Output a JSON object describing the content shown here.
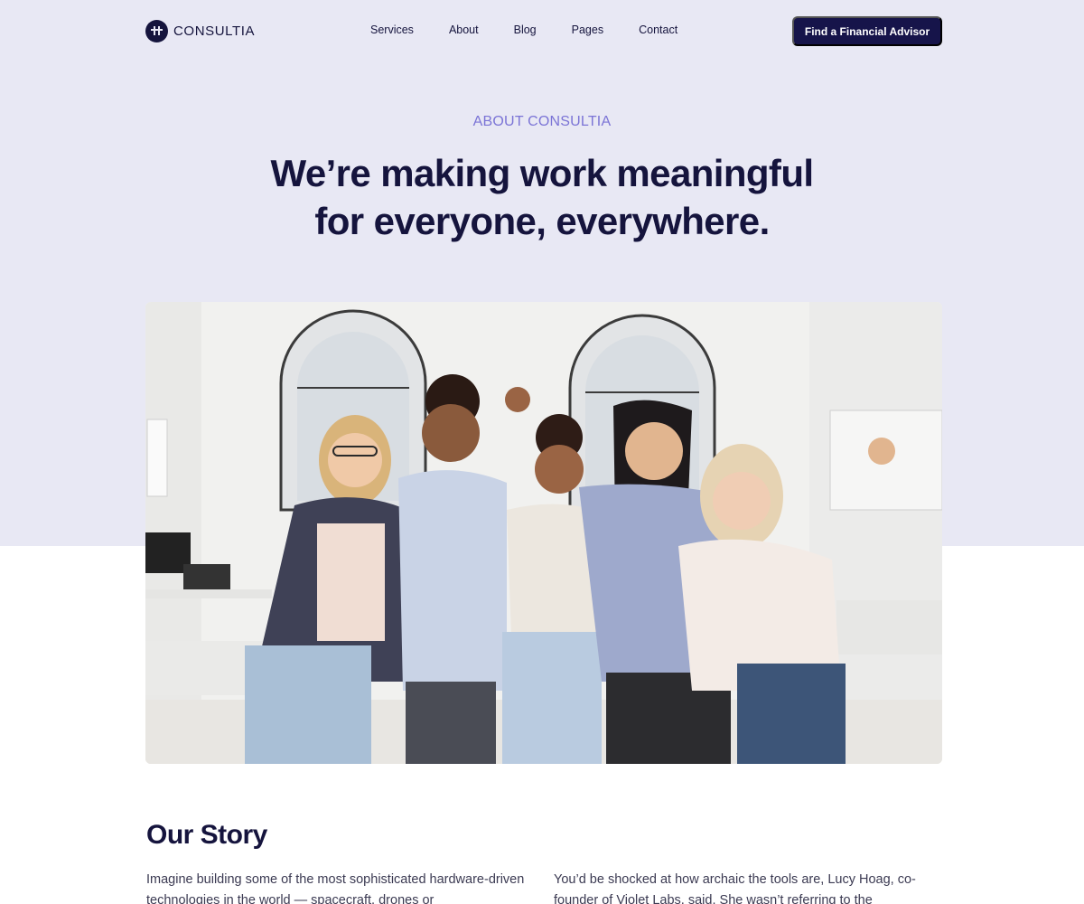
{
  "brand": {
    "name": "CONSULTIA",
    "logo_icon": "logo-mark-icon"
  },
  "nav": {
    "items": [
      "Services",
      "About",
      "Blog",
      "Pages",
      "Contact"
    ],
    "cta_label": "Find a Financial Advisor"
  },
  "hero": {
    "eyebrow": "ABOUT CONSULTIA",
    "headline_line1": "We’re making work meaningful",
    "headline_line2": "for everyone, everywhere."
  },
  "story": {
    "title": "Our Story",
    "left_paragraph": "Imagine building some of the most sophisticated hardware-driven technologies in the world — spacecraft, drones or",
    "right_paragraph": "You’d be shocked at how archaic the tools are, Lucy Hoag, co-founder of Violet Labs, said. She wasn’t referring to the"
  },
  "colors": {
    "hero_background": "#e8e8f4",
    "accent": "#7b74d6",
    "navy": "#15143d",
    "cta_background": "#16144a"
  }
}
